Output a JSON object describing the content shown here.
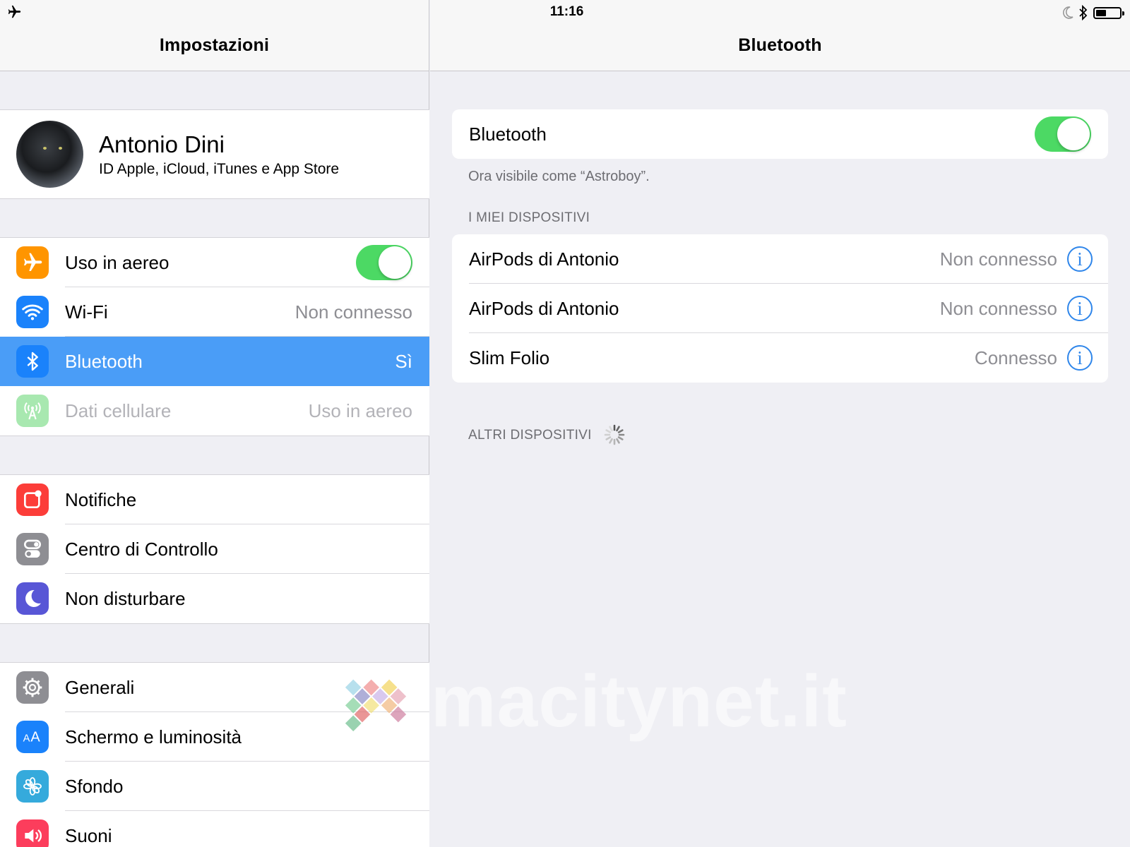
{
  "status_bar": {
    "time": "11:16",
    "icons": [
      "airplane-icon",
      "moon-icon",
      "bluetooth-icon",
      "battery-icon"
    ],
    "battery_level_percent": 45
  },
  "master": {
    "title": "Impostazioni",
    "profile": {
      "name": "Antonio Dini",
      "subtitle": "ID Apple, iCloud, iTunes e App Store"
    },
    "groups": [
      {
        "items": [
          {
            "label": "Uso in aereo",
            "icon": "airplane-icon",
            "icon_color": "#ff9500",
            "toggle": true
          },
          {
            "label": "Wi-Fi",
            "value": "Non connesso",
            "icon": "wifi-icon",
            "icon_color": "#1a82fb"
          },
          {
            "label": "Bluetooth",
            "value": "Sì",
            "icon": "bluetooth-icon",
            "icon_color": "#1a82fb",
            "selected": true
          },
          {
            "label": "Dati cellulare",
            "value": "Uso in aereo",
            "icon": "cellular-icon",
            "icon_color": "#a8e8b0",
            "disabled": true
          }
        ]
      },
      {
        "items": [
          {
            "label": "Notifiche",
            "icon": "notifications-icon",
            "icon_color": "#fc3d39"
          },
          {
            "label": "Centro di Controllo",
            "icon": "control-center-icon",
            "icon_color": "#8e8e93"
          },
          {
            "label": "Non disturbare",
            "icon": "moon-icon",
            "icon_color": "#5856d6"
          }
        ]
      },
      {
        "items": [
          {
            "label": "Generali",
            "icon": "gear-icon",
            "icon_color": "#8e8e93"
          },
          {
            "label": "Schermo e luminosità",
            "icon": "display-icon",
            "icon_color": "#1a82fb"
          },
          {
            "label": "Sfondo",
            "icon": "wallpaper-icon",
            "icon_color": "#35aadc"
          },
          {
            "label": "Suoni",
            "icon": "sounds-icon",
            "icon_color": "#fc3d5c"
          }
        ]
      }
    ]
  },
  "detail": {
    "title": "Bluetooth",
    "bluetooth_row": {
      "label": "Bluetooth",
      "toggle": true
    },
    "visible_as": "Ora visibile come “Astroboy”.",
    "my_devices_header": "I MIEI DISPOSITIVI",
    "devices": [
      {
        "name": "AirPods di Antonio",
        "status": "Non connesso"
      },
      {
        "name": "AirPods di Antonio",
        "status": "Non connesso"
      },
      {
        "name": "Slim Folio",
        "status": "Connesso"
      }
    ],
    "other_devices_header": "ALTRI DISPOSITIVI",
    "info_glyph": "i"
  },
  "watermark": {
    "text": "macitynet.it"
  },
  "colors": {
    "accent": "#4a9df7",
    "toggle_on": "#4cd964",
    "info_blue": "#2f86ea"
  }
}
